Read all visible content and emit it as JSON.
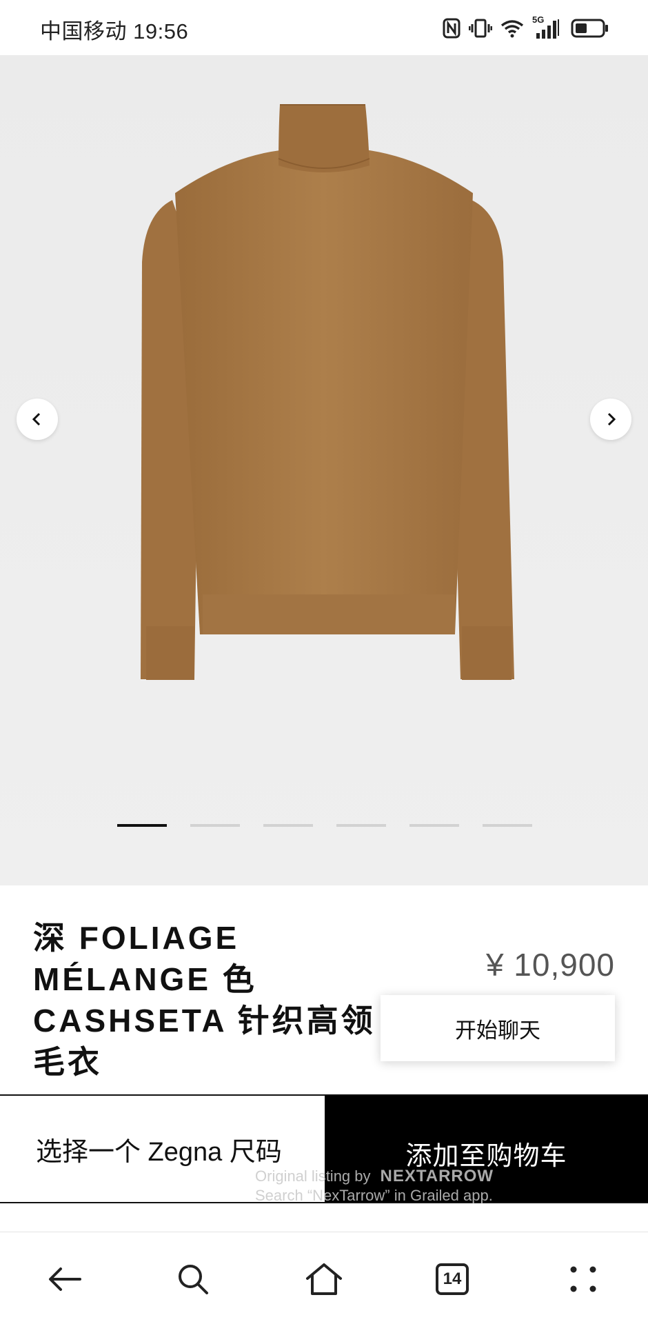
{
  "status_bar": {
    "carrier_time": "中国移动 19:56",
    "network": "5G"
  },
  "gallery": {
    "total_images": 6,
    "active_index": 0,
    "product_color": "#a97a45"
  },
  "product": {
    "title": "深 FOLIAGE MÉLANGE 色 CASHSETA 针织高领毛衣",
    "price": "¥ 10,900"
  },
  "chat_popup": {
    "label": "开始聊天"
  },
  "actions": {
    "size_label": "选择一个 Zegna 尺码",
    "cart_label": "添加至购物车"
  },
  "watermark": {
    "line1": "Original listing by",
    "brand": "NEXTARROW",
    "line2": "Search “NexTarrow” in Grailed app."
  },
  "bottom_nav": {
    "tab_count": "14",
    "icons": [
      "back-arrow-icon",
      "search-icon",
      "home-icon",
      "tabs-icon",
      "more-icon"
    ]
  }
}
